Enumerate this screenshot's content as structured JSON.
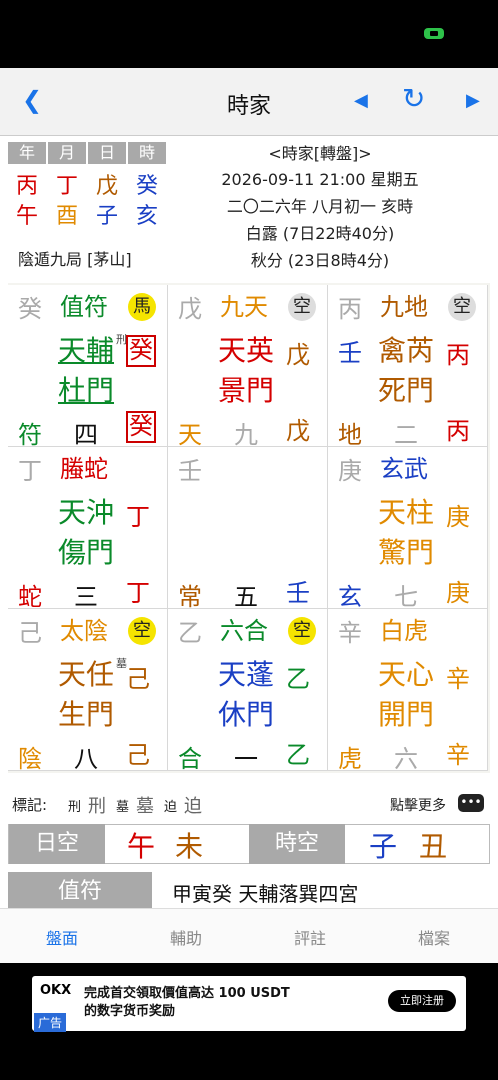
{
  "status": {
    "battery_color": "#2ec24a"
  },
  "nav": {
    "title": "時家",
    "back_icon": "chevron-left-icon",
    "prev_icon": "triangle-left-icon",
    "refresh_icon": "refresh-icon",
    "next_icon": "triangle-right-icon",
    "accent": "#1a73e8"
  },
  "pillars": {
    "headers": [
      "年",
      "月",
      "日",
      "時"
    ],
    "stems": [
      "丙",
      "丁",
      "戊",
      "癸"
    ],
    "branches": [
      "午",
      "酉",
      "子",
      "亥"
    ]
  },
  "info": {
    "mode": "<時家[轉盤]>",
    "datetime": "2026-09-11 21:00 星期五",
    "lunar": "二〇二六年 八月初一 亥時",
    "jieqi1": "白露 (7日22時40分)",
    "jieqi2": "秋分 (23日8時4分)",
    "ju": "陰遁九局 [茅山]"
  },
  "palaces": [
    {
      "tl": "癸",
      "god": "值符",
      "badge": "馬",
      "star": "天輔",
      "door": "杜門",
      "mark1": "刑",
      "right1": "癸",
      "right2": "",
      "bl": "符",
      "num": "四",
      "br": "癸"
    },
    {
      "tl": "戊",
      "god": "九天",
      "badge": "空",
      "star": "天英",
      "door": "景門",
      "right1": "戊",
      "bl": "天",
      "num": "九",
      "br": "戊"
    },
    {
      "tl": "丙",
      "god": "九地",
      "badge": "空",
      "star": "禽芮",
      "door": "死門",
      "left1": "壬",
      "right1": "丙",
      "bl": "地",
      "num": "二",
      "br": "丙"
    },
    {
      "tl": "丁",
      "god": "螣蛇",
      "star": "天沖",
      "door": "傷門",
      "right1": "丁",
      "bl": "蛇",
      "num": "三",
      "br": "丁"
    },
    {
      "tl": "壬",
      "bl": "常",
      "num": "五",
      "br": "壬"
    },
    {
      "tl": "庚",
      "god": "玄武",
      "star": "天柱",
      "door": "驚門",
      "right1": "庚",
      "bl": "玄",
      "num": "七",
      "br": "庚"
    },
    {
      "tl": "己",
      "god": "太陰",
      "badge": "空",
      "star": "天任",
      "door": "生門",
      "mark1": "墓",
      "right1": "己",
      "bl": "陰",
      "num": "八",
      "br": "己"
    },
    {
      "tl": "乙",
      "god": "六合",
      "badge": "空",
      "star": "天蓬",
      "door": "休門",
      "right1": "乙",
      "bl": "合",
      "num": "一",
      "br": "乙"
    },
    {
      "tl": "辛",
      "god": "白虎",
      "star": "天心",
      "door": "開門",
      "right1": "辛",
      "bl": "虎",
      "num": "六",
      "br": "辛"
    }
  ],
  "legend": {
    "label": "標記:",
    "x1": "刑",
    "x2": "刑",
    "m1": "墓",
    "m2": "墓",
    "p1": "迫",
    "p2": "迫",
    "more": "點擊更多"
  },
  "kong": {
    "day_label": "日空",
    "day_a": "午",
    "day_b": "未",
    "hour_label": "時空",
    "hour_a": "子",
    "hour_b": "丑"
  },
  "zhifu": {
    "label": "值符",
    "value": "甲寅癸 天輔落巽四宮"
  },
  "tabs": [
    "盤面",
    "輔助",
    "評註",
    "檔案"
  ],
  "ad": {
    "logo": "OKX",
    "line1": "完成首交領取價值高达 100 USDT",
    "line2": "的数字货币奖励",
    "tag": "广告",
    "button": "立即注册"
  }
}
